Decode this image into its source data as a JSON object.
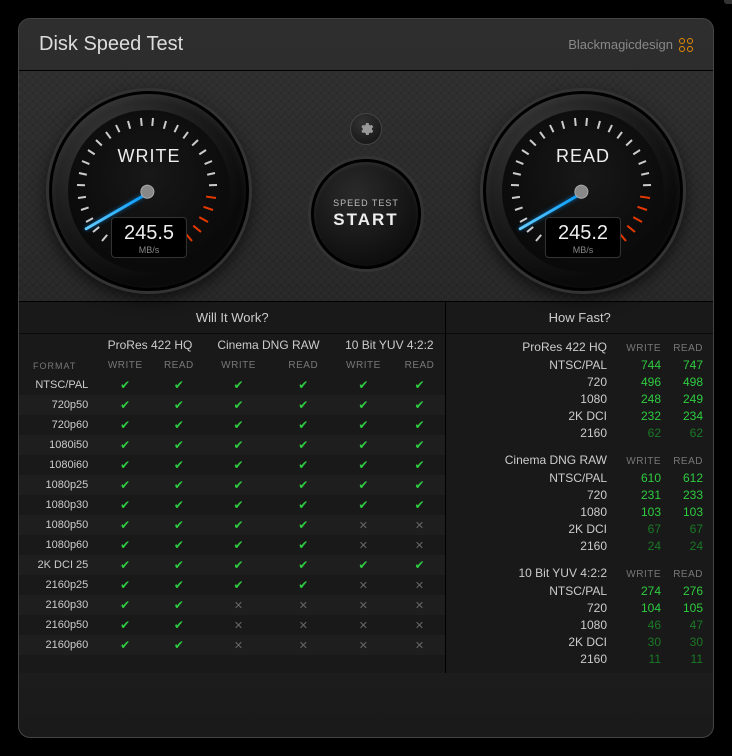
{
  "header": {
    "title": "Disk Speed Test",
    "brand": "Blackmagicdesign"
  },
  "gauges": {
    "write": {
      "label": "WRITE",
      "value": "245.5",
      "unit": "MB/s"
    },
    "read": {
      "label": "READ",
      "value": "245.2",
      "unit": "MB/s"
    }
  },
  "controls": {
    "start_line1": "SPEED TEST",
    "start_line2": "START"
  },
  "panels": {
    "left_title": "Will It Work?",
    "right_title": "How Fast?"
  },
  "left": {
    "format_label": "FORMAT",
    "groups": [
      "ProRes 422 HQ",
      "Cinema DNG RAW",
      "10 Bit YUV 4:2:2"
    ],
    "subcols": [
      "WRITE",
      "READ"
    ],
    "rows": [
      {
        "fmt": "NTSC/PAL",
        "cells": [
          "y",
          "y",
          "y",
          "y",
          "y",
          "y"
        ]
      },
      {
        "fmt": "720p50",
        "cells": [
          "y",
          "y",
          "y",
          "y",
          "y",
          "y"
        ]
      },
      {
        "fmt": "720p60",
        "cells": [
          "y",
          "y",
          "y",
          "y",
          "y",
          "y"
        ]
      },
      {
        "fmt": "1080i50",
        "cells": [
          "y",
          "y",
          "y",
          "y",
          "y",
          "y"
        ]
      },
      {
        "fmt": "1080i60",
        "cells": [
          "y",
          "y",
          "y",
          "y",
          "y",
          "y"
        ]
      },
      {
        "fmt": "1080p25",
        "cells": [
          "y",
          "y",
          "y",
          "y",
          "y",
          "y"
        ]
      },
      {
        "fmt": "1080p30",
        "cells": [
          "y",
          "y",
          "y",
          "y",
          "y",
          "y"
        ]
      },
      {
        "fmt": "1080p50",
        "cells": [
          "y",
          "y",
          "y",
          "y",
          "n",
          "n"
        ]
      },
      {
        "fmt": "1080p60",
        "cells": [
          "y",
          "y",
          "y",
          "y",
          "n",
          "n"
        ]
      },
      {
        "fmt": "2K DCI 25",
        "cells": [
          "y",
          "y",
          "y",
          "y",
          "y",
          "y"
        ]
      },
      {
        "fmt": "2160p25",
        "cells": [
          "y",
          "y",
          "y",
          "y",
          "n",
          "n"
        ]
      },
      {
        "fmt": "2160p30",
        "cells": [
          "y",
          "y",
          "n",
          "n",
          "n",
          "n"
        ]
      },
      {
        "fmt": "2160p50",
        "cells": [
          "y",
          "y",
          "n",
          "n",
          "n",
          "n"
        ]
      },
      {
        "fmt": "2160p60",
        "cells": [
          "y",
          "y",
          "n",
          "n",
          "n",
          "n"
        ]
      }
    ]
  },
  "right": {
    "subcols": [
      "WRITE",
      "READ"
    ],
    "sections": [
      {
        "name": "ProRes 422 HQ",
        "rows": [
          {
            "fmt": "NTSC/PAL",
            "w": "744",
            "r": "747"
          },
          {
            "fmt": "720",
            "w": "496",
            "r": "498"
          },
          {
            "fmt": "1080",
            "w": "248",
            "r": "249"
          },
          {
            "fmt": "2K DCI",
            "w": "232",
            "r": "234"
          },
          {
            "fmt": "2160",
            "w": "62",
            "r": "62",
            "dim": true
          }
        ]
      },
      {
        "name": "Cinema DNG RAW",
        "rows": [
          {
            "fmt": "NTSC/PAL",
            "w": "610",
            "r": "612"
          },
          {
            "fmt": "720",
            "w": "231",
            "r": "233"
          },
          {
            "fmt": "1080",
            "w": "103",
            "r": "103"
          },
          {
            "fmt": "2K DCI",
            "w": "67",
            "r": "67",
            "dim": true
          },
          {
            "fmt": "2160",
            "w": "24",
            "r": "24",
            "dim": true
          }
        ]
      },
      {
        "name": "10 Bit YUV 4:2:2",
        "rows": [
          {
            "fmt": "NTSC/PAL",
            "w": "274",
            "r": "276"
          },
          {
            "fmt": "720",
            "w": "104",
            "r": "105"
          },
          {
            "fmt": "1080",
            "w": "46",
            "r": "47",
            "dim": true
          },
          {
            "fmt": "2K DCI",
            "w": "30",
            "r": "30",
            "dim": true
          },
          {
            "fmt": "2160",
            "w": "11",
            "r": "11",
            "dim": true
          }
        ]
      }
    ]
  }
}
